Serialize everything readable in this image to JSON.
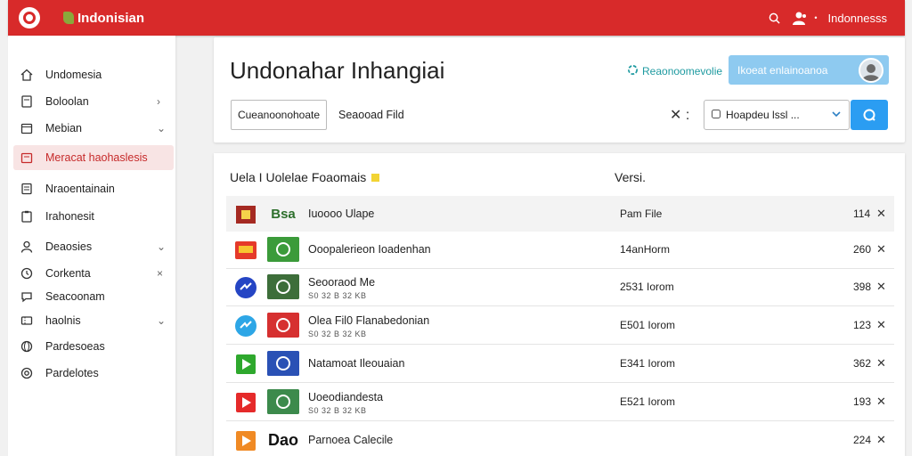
{
  "header": {
    "brand": "Indonisian",
    "language": "Indonnesss"
  },
  "sidebar": {
    "items": [
      {
        "label": "Undomesia",
        "icon": "home-icon",
        "chevron": ""
      },
      {
        "label": "Boloolan",
        "icon": "document-icon",
        "chevron": "›"
      },
      {
        "label": "Mebian",
        "icon": "calendar-icon",
        "chevron": "⌄"
      },
      {
        "label": "Meracat haohaslesis",
        "icon": "folder-icon",
        "chevron": "",
        "active": true
      },
      {
        "label": "Nraoentainain",
        "icon": "file-icon",
        "chevron": ""
      },
      {
        "label": "Irahonesit",
        "icon": "clipboard-icon",
        "chevron": ""
      },
      {
        "label": "Deaosies",
        "icon": "user-icon",
        "chevron": "⌄"
      },
      {
        "label": "Corkenta",
        "icon": "clock-icon",
        "chevron": "×"
      },
      {
        "label": "Seacoonam",
        "icon": "chat-icon",
        "chevron": ""
      },
      {
        "label": "haolnis",
        "icon": "ticket-icon",
        "chevron": "⌄"
      },
      {
        "label": "Pardesoeas",
        "icon": "globe-icon",
        "chevron": ""
      },
      {
        "label": "Pardelotes",
        "icon": "target-icon",
        "chevron": ""
      }
    ]
  },
  "main": {
    "title": "Undonahar Inhangiai",
    "action_link": "Reaonoomevolie",
    "user_box": "Ikoeat enlainoanoa",
    "btn_outline": "Cueanoonohoate",
    "btn_plain": "Seaooad Fild",
    "filter_x": "✕ :",
    "select_value": "Hoapdeu lssl ...",
    "list_header": "Uela I Uolelae Foaomais",
    "col_version": "Versi."
  },
  "rows": [
    {
      "title": "Iuoooo Ulape",
      "sub": "",
      "version": "Pam File",
      "num": "114",
      "icon1_color": "#a52a22",
      "icon2_text": "Bsa",
      "icon2_color": "#2d6f2c",
      "icon2_bg": "#f3f3f3"
    },
    {
      "title": "Ooopalerieon Ioadenhan",
      "sub": "",
      "version": "14anHorm",
      "num": "260",
      "icon1_color": "#e53a2a",
      "icon2_text": "",
      "icon2_color": "#ffffff",
      "icon2_bg": "#3b9b3a"
    },
    {
      "title": "Seooraod Me",
      "sub": "S0 32 B 32 KB",
      "version": "2531 Iorom",
      "num": "398",
      "icon1_color": "#2545c4",
      "icon2_text": "",
      "icon2_color": "#ffffff",
      "icon2_bg": "#3d6e3a"
    },
    {
      "title": "Olea Fil0 Flanabedonian",
      "sub": "S0 32 B 32 KB",
      "version": "E501 Iorom",
      "num": "123",
      "icon1_color": "#2da6e6",
      "icon2_text": "",
      "icon2_color": "#ffffff",
      "icon2_bg": "#d63030"
    },
    {
      "title": "Natamoat Ileouaian",
      "sub": "",
      "version": "E341 Iorom",
      "num": "362",
      "icon1_color": "#2ea82d",
      "icon2_text": "",
      "icon2_color": "#ffffff",
      "icon2_bg": "#2a51b5"
    },
    {
      "title": "Uoeodiandesta",
      "sub": "S0 32 B 32 KB",
      "version": "E521 Iorom",
      "num": "193",
      "icon1_color": "#e52a2a",
      "icon2_text": "",
      "icon2_color": "#ffffff",
      "icon2_bg": "#3c8a4c"
    },
    {
      "title": "Parnoea Calecile",
      "sub": "",
      "version": "",
      "num": "224",
      "icon1_color": "#f08a24",
      "icon2_text": "Dao",
      "icon2_color": "#111111",
      "icon2_bg": "#ffffff"
    }
  ]
}
